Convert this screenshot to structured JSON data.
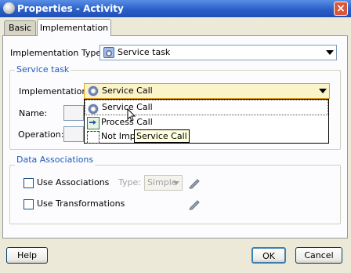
{
  "window": {
    "title": "Properties - Activity",
    "icon": "properties-gear-icon"
  },
  "tabs": [
    {
      "label": "Basic",
      "active": false
    },
    {
      "label": "Implementation",
      "active": true
    }
  ],
  "impl_type": {
    "label": "Implementation Type:",
    "value": "Service task",
    "icon": "service-task-icon"
  },
  "service_task": {
    "title": "Service task",
    "impl_label": "Implementation:",
    "impl_value": "Service Call",
    "name_label": "Name:",
    "operation_label": "Operation:"
  },
  "dropdown": {
    "items": [
      {
        "label": "Service Call",
        "icon": "service-call-gear-icon"
      },
      {
        "label": "Process Call",
        "icon": "process-call-icon"
      },
      {
        "label": "Not Imple",
        "icon": "not-implemented-icon"
      }
    ],
    "tooltip": "Service Call"
  },
  "data_assoc": {
    "title": "Data Associations",
    "use_assoc_label": "Use Associations",
    "type_label": "Type:",
    "type_value": "Simple",
    "use_transform_label": "Use Transformations"
  },
  "buttons": {
    "help": "Help",
    "ok": "OK",
    "cancel": "Cancel"
  },
  "colors": {
    "title_bar": "#2a5fc8",
    "group_title": "#1f5cbd",
    "focus_border": "#e0a020",
    "highlight": "#fbf4c8"
  }
}
